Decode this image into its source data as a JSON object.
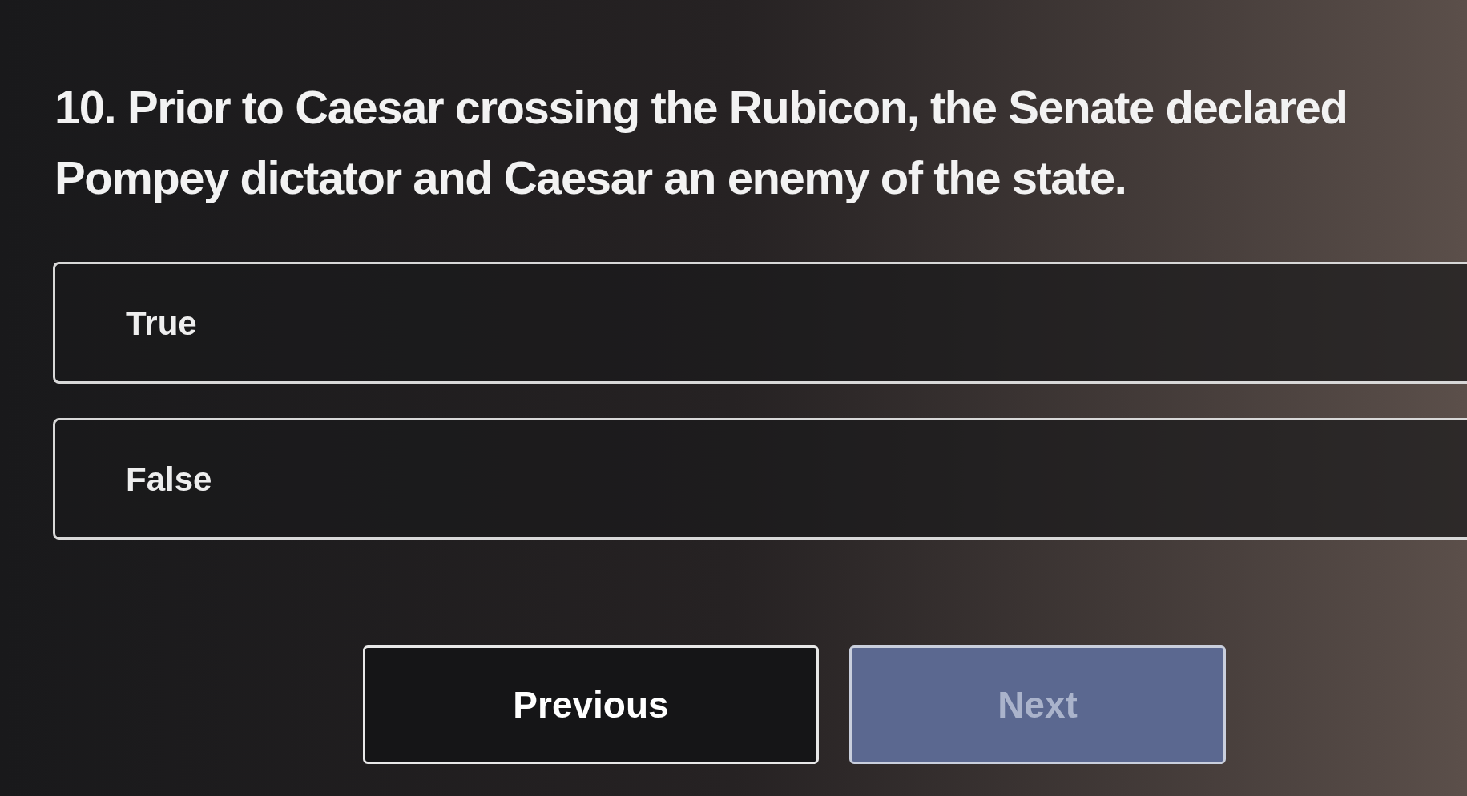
{
  "question": "10. Prior to Caesar crossing the Rubicon, the Senate declared Pompey dictator and Caesar an enemy of the state.",
  "options": [
    {
      "label": "True",
      "selected": false
    },
    {
      "label": "False",
      "selected": false
    }
  ],
  "buttons": [
    {
      "label": "Previous",
      "kind": "secondary",
      "disabled": false
    },
    {
      "label": "Next",
      "kind": "primary",
      "disabled": true
    }
  ]
}
